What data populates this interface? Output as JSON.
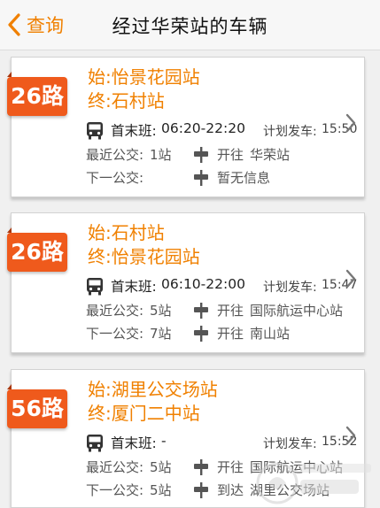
{
  "header": {
    "back_label": "查询",
    "title": "经过华荣站的车辆"
  },
  "cards": [
    {
      "route": "26路",
      "start": "始:怡景花园站",
      "end": "终:石村站",
      "schedule_label": "首末班:",
      "schedule_value": "06:20-22:20",
      "plan_label": "计划发车:",
      "plan_value": "15:50",
      "nearest_label": "最近公交:",
      "nearest_value": "1站",
      "nearest_status": "开往",
      "nearest_station": "华荣站",
      "next_label": "下一公交:",
      "next_value": "",
      "next_status": "暂无信息",
      "next_station": ""
    },
    {
      "route": "26路",
      "start": "始:石村站",
      "end": "终:怡景花园站",
      "schedule_label": "首末班:",
      "schedule_value": "06:10-22:00",
      "plan_label": "计划发车:",
      "plan_value": "15:47",
      "nearest_label": "最近公交:",
      "nearest_value": "5站",
      "nearest_status": "开往",
      "nearest_station": "国际航运中心站",
      "next_label": "下一公交:",
      "next_value": "7站",
      "next_status": "开往",
      "next_station": "南山站"
    },
    {
      "route": "56路",
      "start": "始:湖里公交场站",
      "end": "终:厦门二中站",
      "schedule_label": "首末班:",
      "schedule_value": "-",
      "plan_label": "计划发车:",
      "plan_value": "15:52",
      "nearest_label": "最近公交:",
      "nearest_value": "5站",
      "nearest_status": "开往",
      "nearest_station": "国际航运中心站",
      "next_label": "下一公交:",
      "next_value": "5站",
      "next_status": "到达",
      "next_station": "湖里公交场站"
    }
  ],
  "colors": {
    "accent": "#f08000",
    "badge": "#ef5a1c"
  },
  "icons": [
    "back-arrow-icon",
    "bus-icon",
    "bus-stop-icon",
    "chevron-right-icon"
  ]
}
